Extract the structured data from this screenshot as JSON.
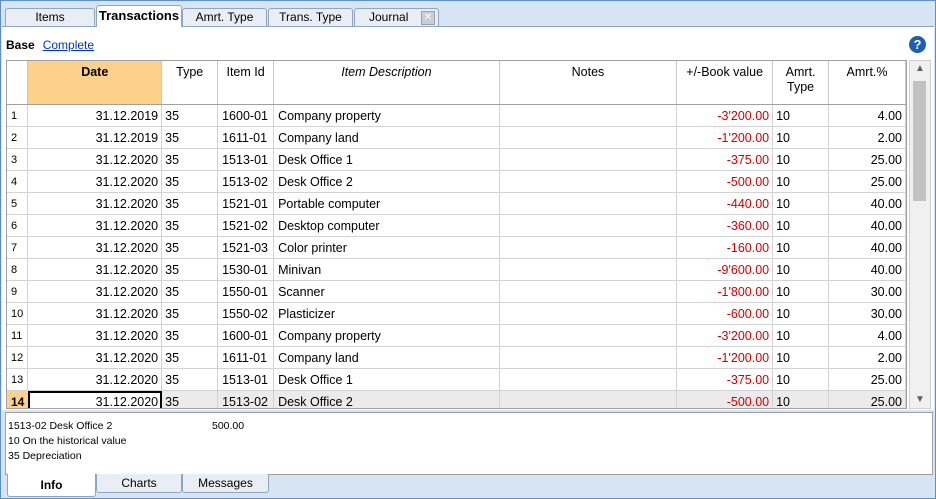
{
  "tabs": [
    "Items",
    "Transactions",
    "Amrt. Type",
    "Trans. Type",
    "Journal"
  ],
  "view": {
    "base": "Base",
    "complete": "Complete"
  },
  "help_icon": "?",
  "columns": [
    "Date",
    "Type",
    "Item Id",
    "Item Description",
    "Notes",
    "+/-Book value",
    "Amrt. Type",
    "Amrt.%"
  ],
  "rows": [
    {
      "n": "1",
      "date": "31.12.2019",
      "type": "35",
      "id": "1600-01",
      "desc": "Company property",
      "notes": "",
      "bv": "-3'200.00",
      "at": "10",
      "pct": "4.00"
    },
    {
      "n": "2",
      "date": "31.12.2019",
      "type": "35",
      "id": "1611-01",
      "desc": "Company land",
      "notes": "",
      "bv": "-1'200.00",
      "at": "10",
      "pct": "2.00"
    },
    {
      "n": "3",
      "date": "31.12.2020",
      "type": "35",
      "id": "1513-01",
      "desc": "Desk Office 1",
      "notes": "",
      "bv": "-375.00",
      "at": "10",
      "pct": "25.00"
    },
    {
      "n": "4",
      "date": "31.12.2020",
      "type": "35",
      "id": "1513-02",
      "desc": "Desk Office 2",
      "notes": "",
      "bv": "-500.00",
      "at": "10",
      "pct": "25.00"
    },
    {
      "n": "5",
      "date": "31.12.2020",
      "type": "35",
      "id": "1521-01",
      "desc": "Portable computer",
      "notes": "",
      "bv": "-440.00",
      "at": "10",
      "pct": "40.00"
    },
    {
      "n": "6",
      "date": "31.12.2020",
      "type": "35",
      "id": "1521-02",
      "desc": "Desktop computer",
      "notes": "",
      "bv": "-360.00",
      "at": "10",
      "pct": "40.00"
    },
    {
      "n": "7",
      "date": "31.12.2020",
      "type": "35",
      "id": "1521-03",
      "desc": "Color printer",
      "notes": "",
      "bv": "-160.00",
      "at": "10",
      "pct": "40.00"
    },
    {
      "n": "8",
      "date": "31.12.2020",
      "type": "35",
      "id": "1530-01",
      "desc": "Minivan",
      "notes": "",
      "bv": "-9'600.00",
      "at": "10",
      "pct": "40.00"
    },
    {
      "n": "9",
      "date": "31.12.2020",
      "type": "35",
      "id": "1550-01",
      "desc": "Scanner",
      "notes": "",
      "bv": "-1'800.00",
      "at": "10",
      "pct": "30.00"
    },
    {
      "n": "10",
      "date": "31.12.2020",
      "type": "35",
      "id": "1550-02",
      "desc": "Plasticizer",
      "notes": "",
      "bv": "-600.00",
      "at": "10",
      "pct": "30.00"
    },
    {
      "n": "11",
      "date": "31.12.2020",
      "type": "35",
      "id": "1600-01",
      "desc": "Company property",
      "notes": "",
      "bv": "-3'200.00",
      "at": "10",
      "pct": "4.00"
    },
    {
      "n": "12",
      "date": "31.12.2020",
      "type": "35",
      "id": "1611-01",
      "desc": "Company land",
      "notes": "",
      "bv": "-1'200.00",
      "at": "10",
      "pct": "2.00"
    },
    {
      "n": "13",
      "date": "31.12.2020",
      "type": "35",
      "id": "1513-01",
      "desc": "Desk Office 1",
      "notes": "",
      "bv": "-375.00",
      "at": "10",
      "pct": "25.00"
    },
    {
      "n": "14",
      "date": "31.12.2020",
      "type": "35",
      "id": "1513-02",
      "desc": "Desk Office 2",
      "notes": "",
      "bv": "-500.00",
      "at": "10",
      "pct": "25.00"
    }
  ],
  "selected_row": "14",
  "info": {
    "line1": "1513-02 Desk Office 2",
    "line1_value": "500.00",
    "line2": "10 On the historical value",
    "line3": "35 Depreciation"
  },
  "bottom_tabs": [
    "Info",
    "Charts",
    "Messages"
  ],
  "colors": {
    "accent": "#fcd28a",
    "negative": "#d40000",
    "link": "#0033cc",
    "frame": "#d6e4f4"
  }
}
